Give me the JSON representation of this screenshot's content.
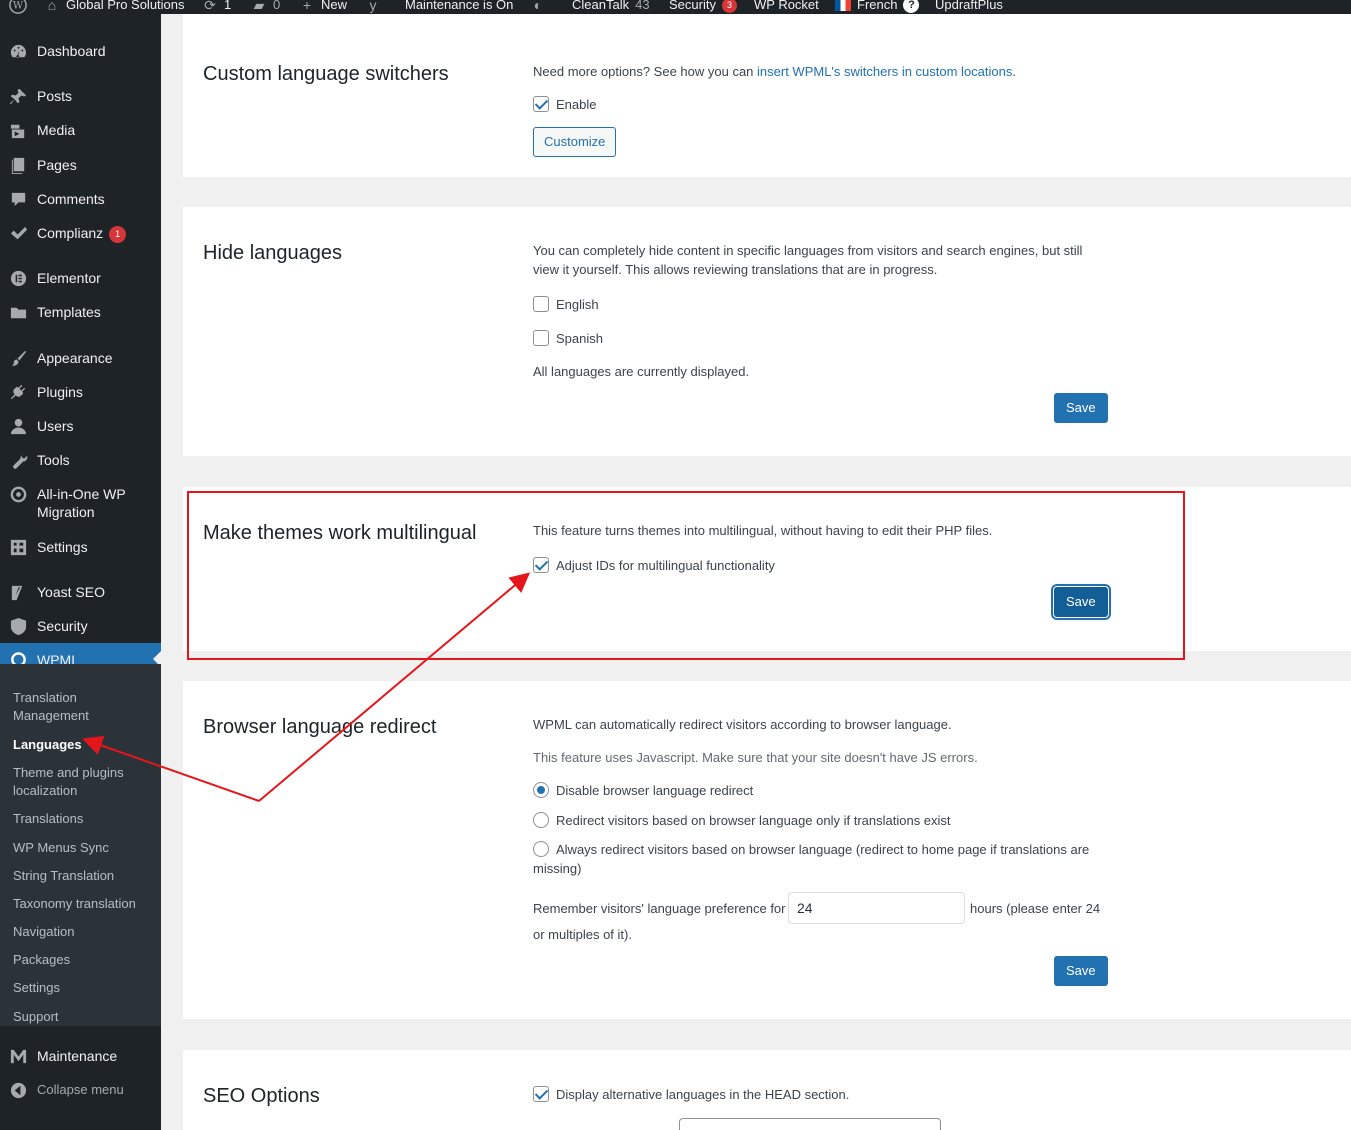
{
  "adminbar": {
    "site_name": "Global Pro Solutions",
    "updates_count": "1",
    "comments_count": "0",
    "new_label": "New",
    "maintenance_label": "Maintenance is On",
    "cleantalk_label": "CleanTalk",
    "cleantalk_count": "43",
    "security_label": "Security",
    "security_count": "3",
    "wprocket_label": "WP Rocket",
    "language_label": "French",
    "updraft_label": "UpdraftPlus"
  },
  "menu": {
    "dashboard": "Dashboard",
    "posts": "Posts",
    "media": "Media",
    "pages": "Pages",
    "comments": "Comments",
    "complianz": "Complianz",
    "complianz_badge": "1",
    "elementor": "Elementor",
    "templates": "Templates",
    "appearance": "Appearance",
    "plugins": "Plugins",
    "users": "Users",
    "tools": "Tools",
    "allinone_1": "All-in-One WP",
    "allinone_2": "Migration",
    "settings": "Settings",
    "yoast": "Yoast SEO",
    "security": "Security",
    "wpml": "WPML",
    "maintenance": "Maintenance",
    "collapse": "Collapse menu"
  },
  "submenu": {
    "translation_management_1": "Translation",
    "translation_management_2": "Management",
    "languages": "Languages",
    "theme_plugins_1": "Theme and plugins",
    "theme_plugins_2": "localization",
    "translations": "Translations",
    "wp_menus_sync": "WP Menus Sync",
    "string_translation": "String Translation",
    "taxonomy_translation": "Taxonomy translation",
    "navigation": "Navigation",
    "packages": "Packages",
    "settings": "Settings",
    "support": "Support"
  },
  "custom_switchers": {
    "title": "Custom language switchers",
    "intro": "Need more options? See how you can ",
    "link": "insert WPML's switchers in custom locations",
    "intro_end": ".",
    "enable_label": "Enable",
    "enable_checked": true,
    "customize_button": "Customize"
  },
  "hide_languages": {
    "title": "Hide languages",
    "description": "You can completely hide content in specific languages from visitors and search engines, but still view it yourself. This allows reviewing translations that are in progress.",
    "languages": [
      {
        "label": "English",
        "checked": false
      },
      {
        "label": "Spanish",
        "checked": false
      }
    ],
    "status": "All languages are currently displayed.",
    "save_button": "Save"
  },
  "themes_multilingual": {
    "title": "Make themes work multilingual",
    "description": "This feature turns themes into multilingual, without having to edit their PHP files.",
    "adjust_ids_label": "Adjust IDs for multilingual functionality",
    "adjust_ids_checked": true,
    "save_button": "Save"
  },
  "browser_redirect": {
    "title": "Browser language redirect",
    "description": "WPML can automatically redirect visitors according to browser language.",
    "note": "This feature uses Javascript. Make sure that your site doesn't have JS errors.",
    "options": [
      {
        "label": "Disable browser language redirect",
        "selected": true
      },
      {
        "label": "Redirect visitors based on browser language only if translations exist",
        "selected": false
      },
      {
        "label": "Always redirect visitors based on browser language (redirect to home page if translations are",
        "label_cont": "missing)",
        "selected": false
      }
    ],
    "remember_label": "Remember visitors' language preference for",
    "remember_value": "24",
    "hours_label": "hours (please enter 24",
    "hours_label_cont": "or multiples of it).",
    "save_button": "Save"
  },
  "seo_options": {
    "title": "SEO Options",
    "alt_languages_label": "Display alternative languages in the HEAD section.",
    "alt_languages_checked": true
  }
}
